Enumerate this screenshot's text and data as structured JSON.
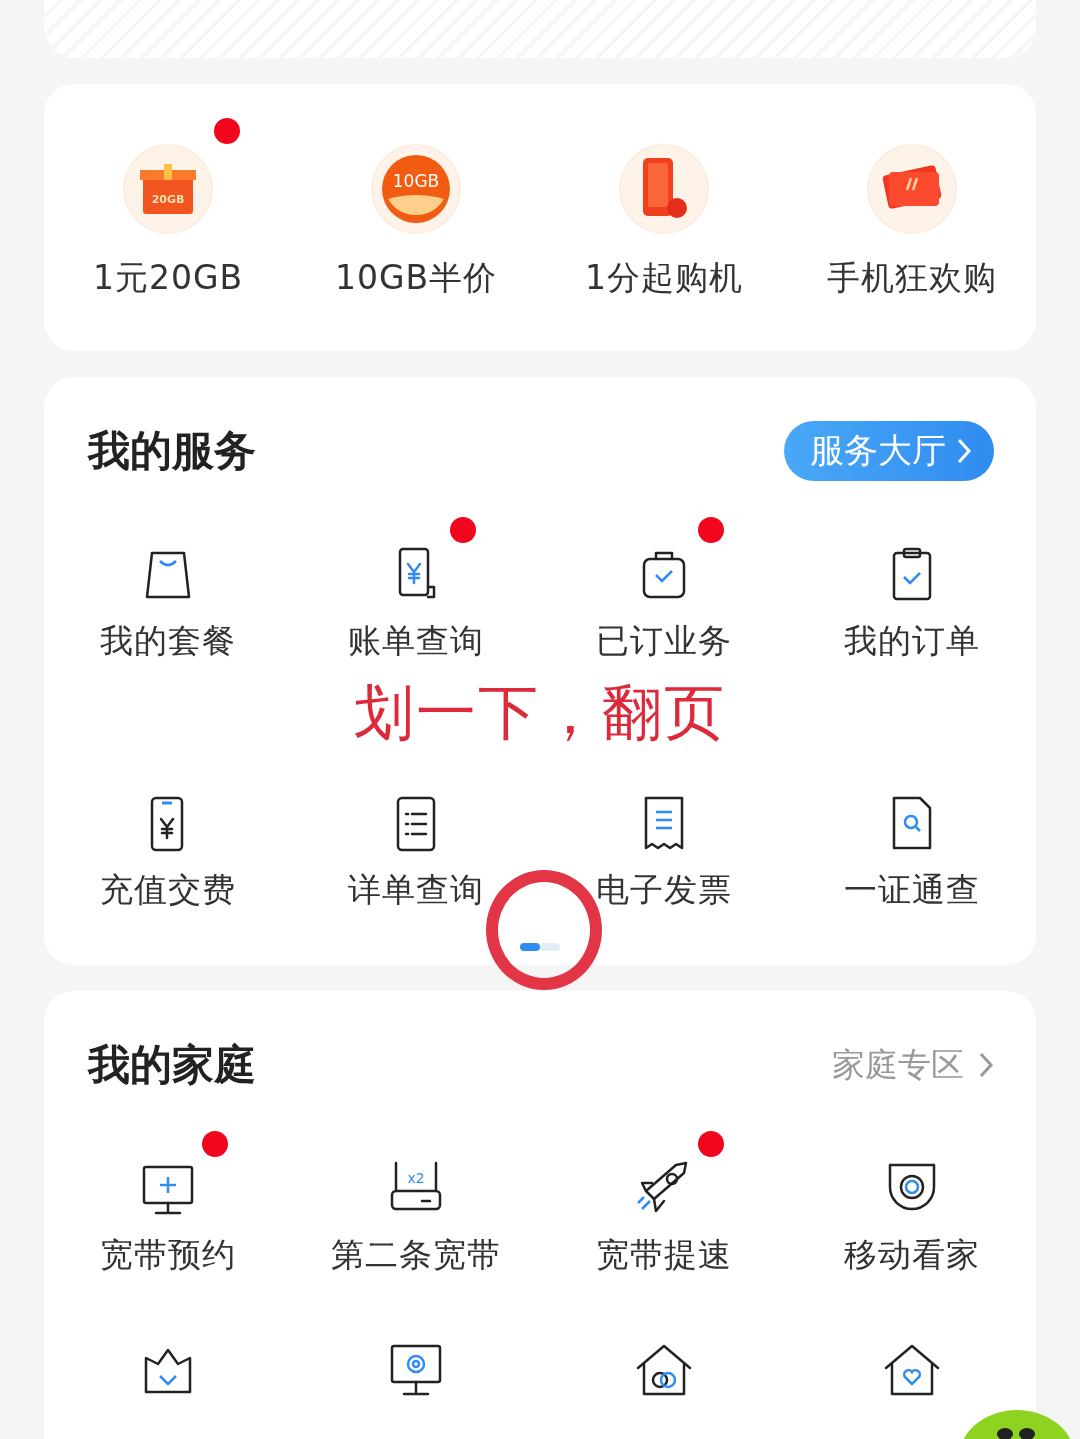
{
  "promos": [
    {
      "label": "1元20GB",
      "icon_text": "20GB",
      "dot": true
    },
    {
      "label": "10GB半价",
      "icon_text": "10GB",
      "dot": false
    },
    {
      "label": "1分起购机",
      "dot": false
    },
    {
      "label": "手机狂欢购",
      "dot": false
    }
  ],
  "services": {
    "title": "我的服务",
    "hall_button": "服务大厅",
    "items": [
      {
        "label": "我的套餐",
        "dot": false
      },
      {
        "label": "账单查询",
        "dot": true
      },
      {
        "label": "已订业务",
        "dot": true
      },
      {
        "label": "我的订单",
        "dot": false
      },
      {
        "label": "充值交费",
        "dot": false
      },
      {
        "label": "详单查询",
        "dot": false
      },
      {
        "label": "电子发票",
        "dot": false
      },
      {
        "label": "一证通查",
        "dot": false
      }
    ],
    "pages": [
      {
        "selected": true
      },
      {
        "selected": false
      }
    ]
  },
  "family": {
    "title": "我的家庭",
    "link": "家庭专区",
    "items": [
      {
        "label": "宽带预约",
        "dot": true
      },
      {
        "label": "第二条宽带",
        "dot": false,
        "icon_text": "x2"
      },
      {
        "label": "宽带提速",
        "dot": true
      },
      {
        "label": "移动看家",
        "dot": false
      }
    ]
  },
  "annotation": {
    "text": "划一下，翻页"
  }
}
